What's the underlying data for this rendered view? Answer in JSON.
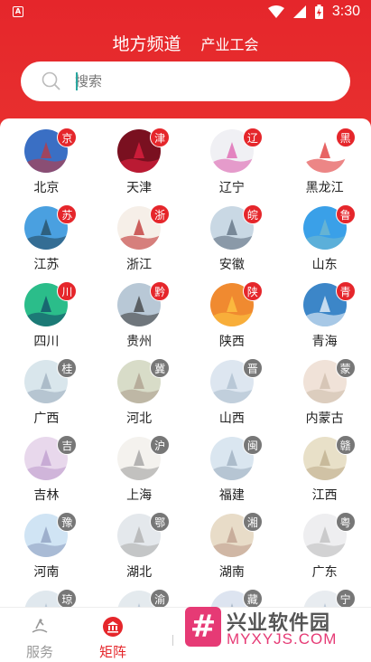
{
  "status_bar": {
    "time": "3:30",
    "app_icon_letter": "A"
  },
  "top_nav": {
    "tabs": [
      "地方频道",
      "产业工会"
    ]
  },
  "search": {
    "placeholder": "搜索"
  },
  "regions": [
    {
      "name": "北京",
      "badge": "京",
      "badge_color": "red",
      "bg": "#3a6fc4",
      "fg": "#c33"
    },
    {
      "name": "天津",
      "badge": "津",
      "badge_color": "red",
      "bg": "#7a1020",
      "fg": "#e24"
    },
    {
      "name": "辽宁",
      "badge": "辽",
      "badge_color": "red",
      "bg": "#f0f0f4",
      "fg": "#d5a"
    },
    {
      "name": "黑龙江",
      "badge": "黑",
      "badge_color": "red",
      "bg": "#ffffff",
      "fg": "#d22"
    },
    {
      "name": "江苏",
      "badge": "苏",
      "badge_color": "red",
      "bg": "#4aa0e0",
      "fg": "#245"
    },
    {
      "name": "浙江",
      "badge": "浙",
      "badge_color": "red",
      "bg": "#f6efe8",
      "fg": "#b22"
    },
    {
      "name": "安徽",
      "badge": "皖",
      "badge_color": "red",
      "bg": "#c9d8e4",
      "fg": "#567"
    },
    {
      "name": "山东",
      "badge": "鲁",
      "badge_color": "red",
      "bg": "#3aa0e8",
      "fg": "#7bc"
    },
    {
      "name": "四川",
      "badge": "川",
      "badge_color": "red",
      "bg": "#2bbd8a",
      "fg": "#146"
    },
    {
      "name": "贵州",
      "badge": "黔",
      "badge_color": "red",
      "bg": "#b8c8d6",
      "fg": "#333"
    },
    {
      "name": "陕西",
      "badge": "陕",
      "badge_color": "red",
      "bg": "#f08a30",
      "fg": "#fc4"
    },
    {
      "name": "青海",
      "badge": "青",
      "badge_color": "red",
      "bg": "#3c86c8",
      "fg": "#fff"
    },
    {
      "name": "广西",
      "badge": "桂",
      "badge_color": "gray",
      "bg": "#d9e6ec",
      "fg": "#9ab"
    },
    {
      "name": "河北",
      "badge": "冀",
      "badge_color": "gray",
      "bg": "#d8dcc8",
      "fg": "#a98"
    },
    {
      "name": "山西",
      "badge": "晋",
      "badge_color": "gray",
      "bg": "#dde6f0",
      "fg": "#abc"
    },
    {
      "name": "内蒙古",
      "badge": "蒙",
      "badge_color": "gray",
      "bg": "#f0e2d8",
      "fg": "#cba"
    },
    {
      "name": "吉林",
      "badge": "吉",
      "badge_color": "gray",
      "bg": "#e8d8ec",
      "fg": "#b9c"
    },
    {
      "name": "上海",
      "badge": "沪",
      "badge_color": "gray",
      "bg": "#f4f2ee",
      "fg": "#999"
    },
    {
      "name": "福建",
      "badge": "闽",
      "badge_color": "gray",
      "bg": "#dae6f0",
      "fg": "#9ab"
    },
    {
      "name": "江西",
      "badge": "赣",
      "badge_color": "gray",
      "bg": "#e8e0c8",
      "fg": "#ba8"
    },
    {
      "name": "河南",
      "badge": "豫",
      "badge_color": "gray",
      "bg": "#d0e4f4",
      "fg": "#89b"
    },
    {
      "name": "湖北",
      "badge": "鄂",
      "badge_color": "gray",
      "bg": "#e4e8ec",
      "fg": "#aaa"
    },
    {
      "name": "湖南",
      "badge": "湘",
      "badge_color": "gray",
      "bg": "#e8dcc8",
      "fg": "#b98"
    },
    {
      "name": "广东",
      "badge": "粤",
      "badge_color": "gray",
      "bg": "#eeeef0",
      "fg": "#bbb"
    },
    {
      "name": "",
      "badge": "琼",
      "badge_color": "gray",
      "bg": "#e0e8ee",
      "fg": "#abc"
    },
    {
      "name": "",
      "badge": "渝",
      "badge_color": "gray",
      "bg": "#e4eaee",
      "fg": "#abc"
    },
    {
      "name": "",
      "badge": "藏",
      "badge_color": "gray",
      "bg": "#dde4f0",
      "fg": "#9ab"
    },
    {
      "name": "",
      "badge": "宁",
      "badge_color": "gray",
      "bg": "#e8ecf0",
      "fg": "#abc"
    }
  ],
  "bottom_nav": {
    "service_label": "服务",
    "matrix_label": "矩阵"
  },
  "watermark": {
    "title": "兴业软件园",
    "url": "MYXYJS.COM",
    "mark": "#"
  },
  "colors": {
    "brand_red": "#e5262b",
    "inactive_gray": "#999",
    "watermark_pink": "#e63a75"
  }
}
